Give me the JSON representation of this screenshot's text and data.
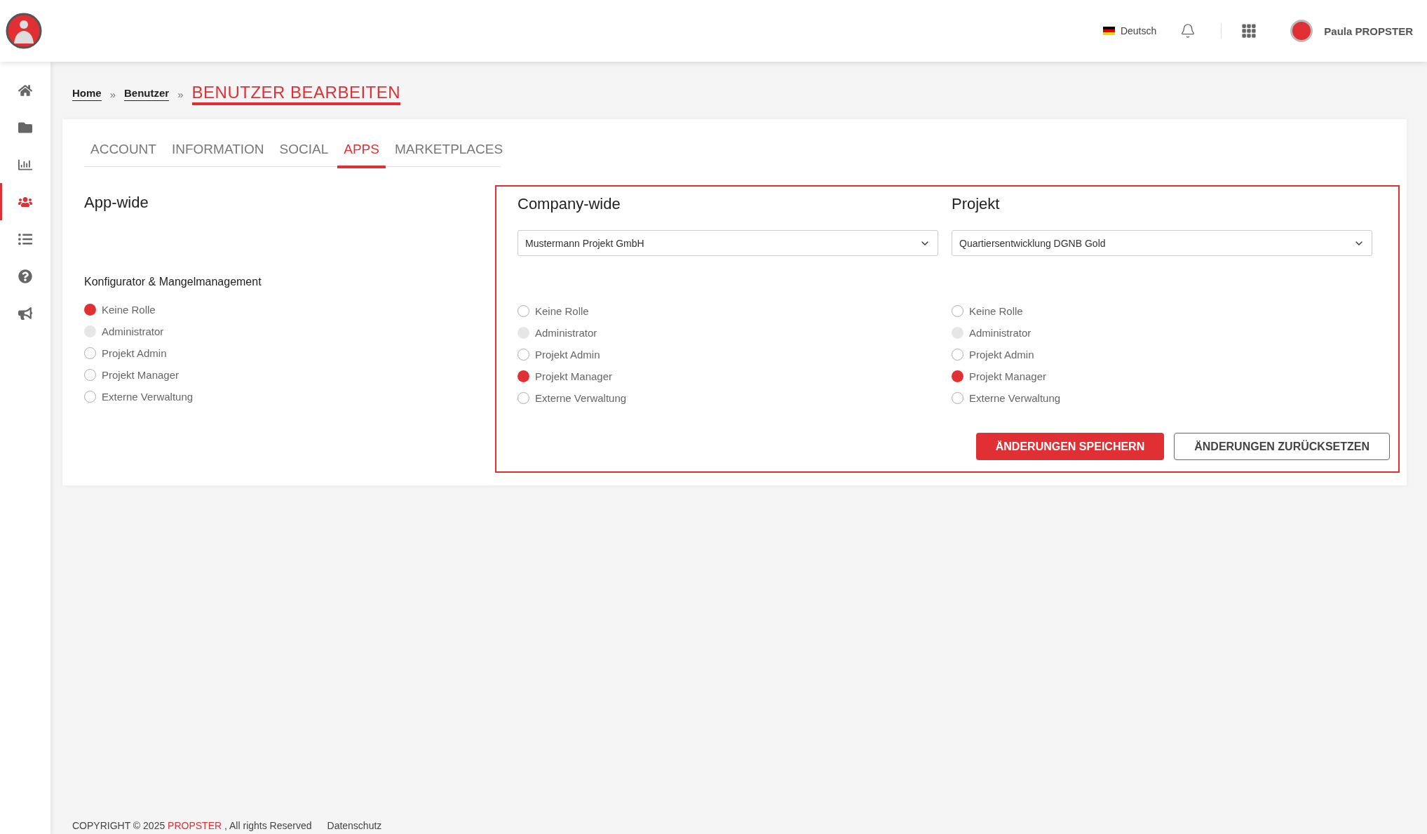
{
  "header": {
    "language": "Deutsch",
    "user_name": "Paula PROPSTER"
  },
  "sidebar": {
    "items": [
      {
        "kind": "home",
        "selected": false
      },
      {
        "kind": "folder",
        "selected": false
      },
      {
        "kind": "chart",
        "selected": false
      },
      {
        "kind": "users",
        "selected": true
      },
      {
        "kind": "list",
        "selected": false
      },
      {
        "kind": "help",
        "selected": false
      },
      {
        "kind": "megaphone",
        "selected": false
      }
    ]
  },
  "breadcrumb": {
    "links": [
      "Home",
      "Benutzer"
    ],
    "separators": [
      "»",
      "»"
    ],
    "current": "BENUTZER BEARBEITEN"
  },
  "tabs": [
    {
      "label": "ACCOUNT",
      "selected": false
    },
    {
      "label": "INFORMATION",
      "selected": false
    },
    {
      "label": "SOCIAL",
      "selected": false
    },
    {
      "label": "APPS",
      "selected": true
    },
    {
      "label": "MARKETPLACES",
      "selected": false
    }
  ],
  "app_wide": {
    "title": "App-wide",
    "group_title": "Konfigurator & Mangelmanagement",
    "options": [
      {
        "label": "Keine Rolle",
        "selected": true,
        "disabled": false
      },
      {
        "label": "Administrator",
        "selected": false,
        "disabled": true
      },
      {
        "label": "Projekt Admin",
        "selected": false,
        "disabled": false
      },
      {
        "label": "Projekt Manager",
        "selected": false,
        "disabled": false
      },
      {
        "label": "Externe Verwaltung",
        "selected": false,
        "disabled": false
      }
    ]
  },
  "scoped": [
    {
      "title": "Company-wide",
      "select": {
        "value": "Mustermann Projekt GmbH"
      },
      "options": [
        {
          "label": "Keine Rolle",
          "selected": false,
          "disabled": false
        },
        {
          "label": "Administrator",
          "selected": false,
          "disabled": true
        },
        {
          "label": "Projekt Admin",
          "selected": false,
          "disabled": false
        },
        {
          "label": "Projekt Manager",
          "selected": true,
          "disabled": false
        },
        {
          "label": "Externe Verwaltung",
          "selected": false,
          "disabled": false
        }
      ]
    },
    {
      "title": "Projekt",
      "select": {
        "value": "Quartiersentwicklung DGNB Gold"
      },
      "options": [
        {
          "label": "Keine Rolle",
          "selected": false,
          "disabled": false
        },
        {
          "label": "Administrator",
          "selected": false,
          "disabled": true
        },
        {
          "label": "Projekt Admin",
          "selected": false,
          "disabled": false
        },
        {
          "label": "Projekt Manager",
          "selected": true,
          "disabled": false
        },
        {
          "label": "Externe Verwaltung",
          "selected": false,
          "disabled": false
        }
      ]
    }
  ],
  "buttons": [
    {
      "label": "ÄNDERUNGEN SPEICHERN",
      "kind": "primary"
    },
    {
      "label": "ÄNDERUNGEN ZURÜCKSETZEN",
      "kind": "secondary"
    }
  ],
  "footer": {
    "copyright": "COPYRIGHT © 2025",
    "brand": "PROPSTER",
    "rights": ", All rights Reserved",
    "privacy": "Datenschutz"
  }
}
